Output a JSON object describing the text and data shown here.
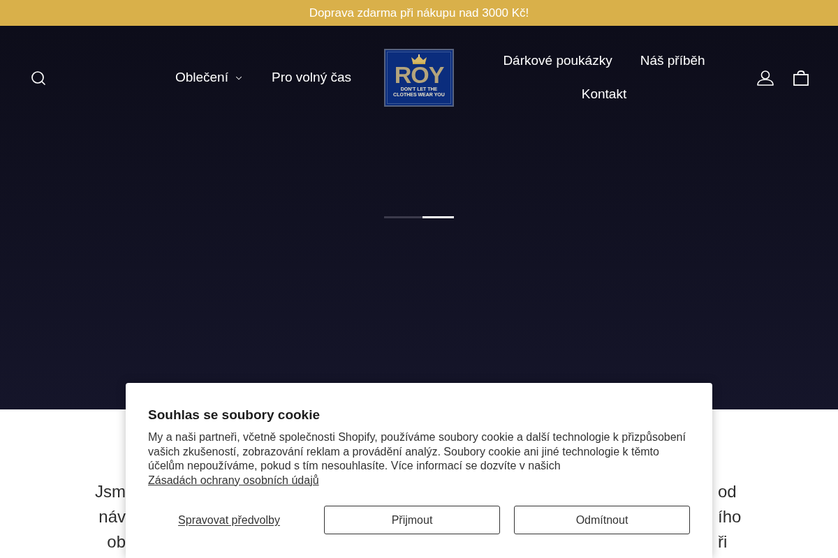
{
  "announcement_bar": {
    "text": "Doprava zdarma při nákupu nad 3000 Kč!"
  },
  "header": {
    "nav_left": [
      {
        "label": "Oblečení",
        "has_dropdown": true
      },
      {
        "label": "Pro volný čas",
        "has_dropdown": false
      }
    ],
    "logo": {
      "wordmark": "ROY",
      "tagline": "DON'T LET THE CLOTHES WEAR YOU"
    },
    "nav_right": [
      {
        "label": "Dárkové poukázky"
      },
      {
        "label": "Náš příběh"
      },
      {
        "label": "Kontakt"
      }
    ]
  },
  "slideshow": {
    "indicators": [
      {
        "selected": false
      },
      {
        "selected": true
      }
    ]
  },
  "intro_text_visible_fragments": [
    {
      "left": "Jsm",
      "right": "od"
    },
    {
      "left": "náv",
      "right": "ího"
    },
    {
      "left": "ob",
      "right": "ři"
    }
  ],
  "cookie_dialog": {
    "title": "Souhlas se soubory cookie",
    "body": "My a naši partneři, včetně společnosti Shopify, používáme soubory cookie a další technologie k přizpůsobení vašich zkušeností, zobrazování reklam a provádění analýz. Soubory cookie ani jiné technologie k těmto účelům nepoužíváme, pokud s tím nesouhlasíte. Více informací se dozvíte v našich",
    "link": "Zásadách ochrany osobních údajů",
    "buttons": [
      {
        "label": "Spravovat předvolby",
        "kind": "link"
      },
      {
        "label": "Přijmout",
        "kind": "outline"
      },
      {
        "label": "Odmítnout",
        "kind": "outline"
      }
    ]
  }
}
